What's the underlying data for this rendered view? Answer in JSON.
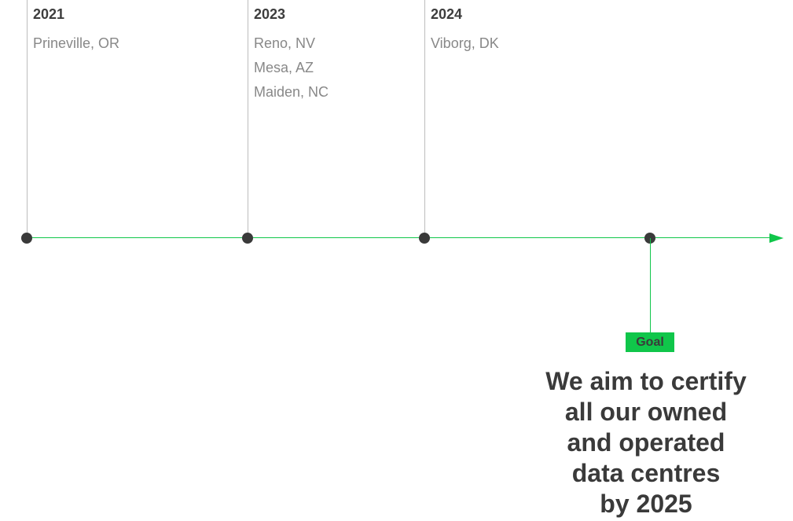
{
  "timeline": {
    "milestones": [
      {
        "year": "2021",
        "locations": [
          "Prineville, OR"
        ]
      },
      {
        "year": "2023",
        "locations": [
          "Reno, NV",
          "Mesa, AZ",
          "Maiden, NC"
        ]
      },
      {
        "year": "2024",
        "locations": [
          "Viborg, DK"
        ]
      }
    ],
    "goal": {
      "badge": "Goal",
      "statement_lines": [
        "We aim to certify",
        "all our owned",
        "and operated",
        "data centres",
        "by 2025"
      ]
    }
  },
  "colors": {
    "accent": "#10c64a",
    "text_dark": "#3a3a3a",
    "text_muted": "#888888",
    "divider": "#bdbdbd"
  }
}
